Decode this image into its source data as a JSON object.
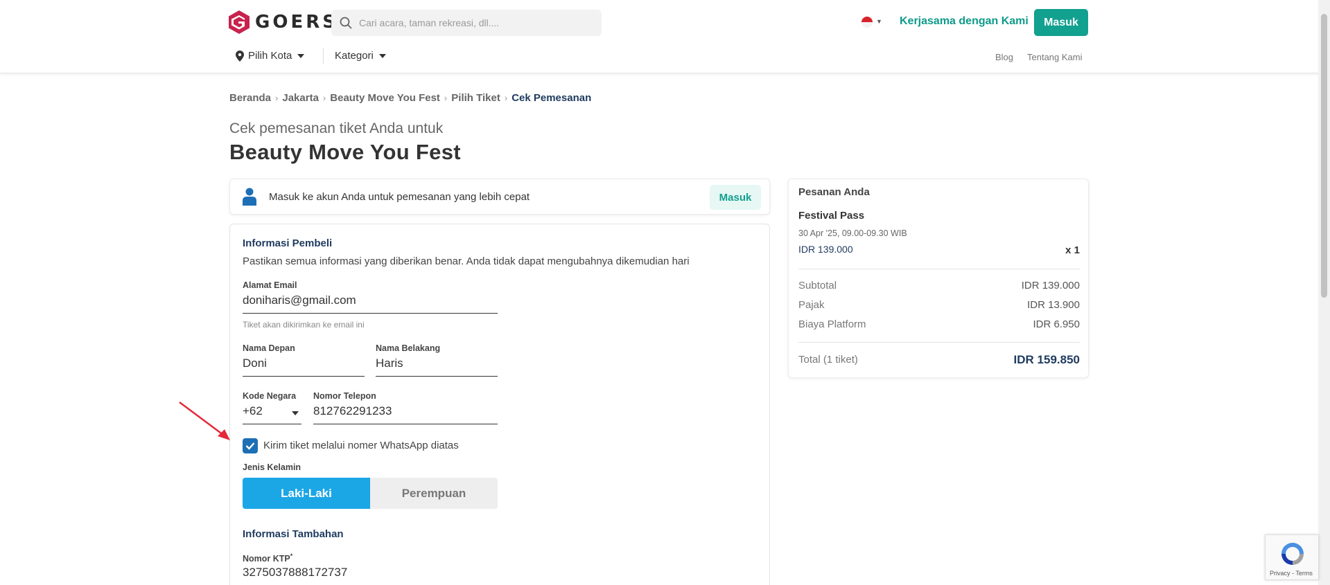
{
  "header": {
    "logo_text": "GOERS",
    "search_placeholder": "Cari acara, taman rekreasi, dll....",
    "partner_link": "Kerjasama dengan Kami",
    "login_button": "Masuk",
    "city_selector": "Pilih Kota",
    "category_menu": "Kategori",
    "links": [
      "Blog",
      "Tentang Kami"
    ]
  },
  "breadcrumb": [
    "Beranda",
    "Jakarta",
    "Beauty Move You Fest",
    "Pilih Tiket",
    "Cek Pemesanan"
  ],
  "page": {
    "pre_title": "Cek pemesanan tiket Anda untuk",
    "title": "Beauty Move You Fest"
  },
  "login_prompt": {
    "message": "Masuk ke akun Anda untuk pemesanan yang lebih cepat",
    "button": "Masuk"
  },
  "buyer_info": {
    "title": "Informasi Pembeli",
    "description": "Pastikan semua informasi yang diberikan benar. Anda tidak dapat mengubahnya dikemudian hari",
    "email_label": "Alamat Email",
    "email_value": "doniharis@gmail.com",
    "email_hint": "Tiket akan dikirimkan ke email ini",
    "first_name_label": "Nama Depan",
    "first_name_value": "Doni",
    "last_name_label": "Nama Belakang",
    "last_name_value": "Haris",
    "country_code_label": "Kode Negara",
    "country_code_value": "+62",
    "phone_label": "Nomor Telepon",
    "phone_value": "812762291233",
    "whatsapp_label": "Kirim tiket melalui nomer WhatsApp diatas",
    "whatsapp_checked": true,
    "gender_label": "Jenis Kelamin",
    "gender_options": [
      "Laki-Laki",
      "Perempuan"
    ],
    "gender_selected": "Laki-Laki"
  },
  "extra_info": {
    "title": "Informasi Tambahan",
    "ktp_label": "Nomor KTP",
    "ktp_required_mark": "*",
    "ktp_value": "3275037888172737"
  },
  "order_summary": {
    "title": "Pesanan Anda",
    "ticket_name": "Festival Pass",
    "ticket_time": "30 Apr '25, 09.00-09.30 WIB",
    "ticket_price": "IDR 139.000",
    "ticket_qty": "x 1",
    "subtotal_label": "Subtotal",
    "subtotal_value": "IDR 139.000",
    "tax_label": "Pajak",
    "tax_value": "IDR 13.900",
    "fee_label": "Biaya Platform",
    "fee_value": "IDR 6.950",
    "total_label": "Total (1 tiket)",
    "total_value": "IDR 159.850"
  },
  "recaptcha": {
    "text": "Privacy - Terms"
  },
  "colors": {
    "brand_teal": "#12a08f",
    "navy": "#1e3a5f",
    "selected_blue": "#1ba6e6",
    "logo_red": "#c8234d",
    "arrow_red": "#e5283a"
  }
}
